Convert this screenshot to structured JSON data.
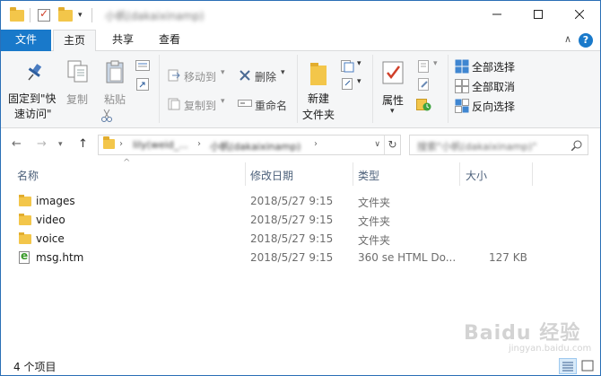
{
  "window": {
    "title": "小帆(dakaixinamp)",
    "min_icon": "minimize-icon",
    "max_icon": "maximize-icon",
    "close_icon": "close-icon"
  },
  "tabs": [
    {
      "label": "文件"
    },
    {
      "label": "主页"
    },
    {
      "label": "共享"
    },
    {
      "label": "查看"
    }
  ],
  "ribbon": {
    "pin_line1": "固定到\"快",
    "pin_line2": "速访问\"",
    "copy": "复制",
    "paste": "粘贴",
    "move_to": "移动到",
    "copy_to": "复制到",
    "delete": "删除",
    "rename": "重命名",
    "new_folder_line1": "新建",
    "new_folder_line2": "文件夹",
    "properties": "属性",
    "select_all": "全部选择",
    "select_none": "全部取消",
    "invert_selection": "反向选择"
  },
  "address": {
    "crumb1": "lily(weid_...",
    "crumb2": "小帆(dakaixinamp)",
    "search_placeholder": "搜索\"小帆(dakaixinamp)\""
  },
  "columns": {
    "name": "名称",
    "date": "修改日期",
    "type": "类型",
    "size": "大小"
  },
  "files": [
    {
      "name": "images",
      "date": "2018/5/27 9:15",
      "type": "文件夹",
      "size": "",
      "icon": "folder-icon"
    },
    {
      "name": "video",
      "date": "2018/5/27 9:15",
      "type": "文件夹",
      "size": "",
      "icon": "folder-icon"
    },
    {
      "name": "voice",
      "date": "2018/5/27 9:15",
      "type": "文件夹",
      "size": "",
      "icon": "folder-icon"
    },
    {
      "name": "msg.htm",
      "date": "2018/5/27 9:15",
      "type": "360 se HTML Do...",
      "size": "127 KB",
      "icon": "html-file-icon"
    }
  ],
  "status": {
    "count": "4 个项目"
  },
  "watermark": {
    "main": "Baidu 经验",
    "sub": "jingyan.baidu.com"
  },
  "colors": {
    "accent": "#1979ca",
    "folder": "#f3c64a"
  }
}
